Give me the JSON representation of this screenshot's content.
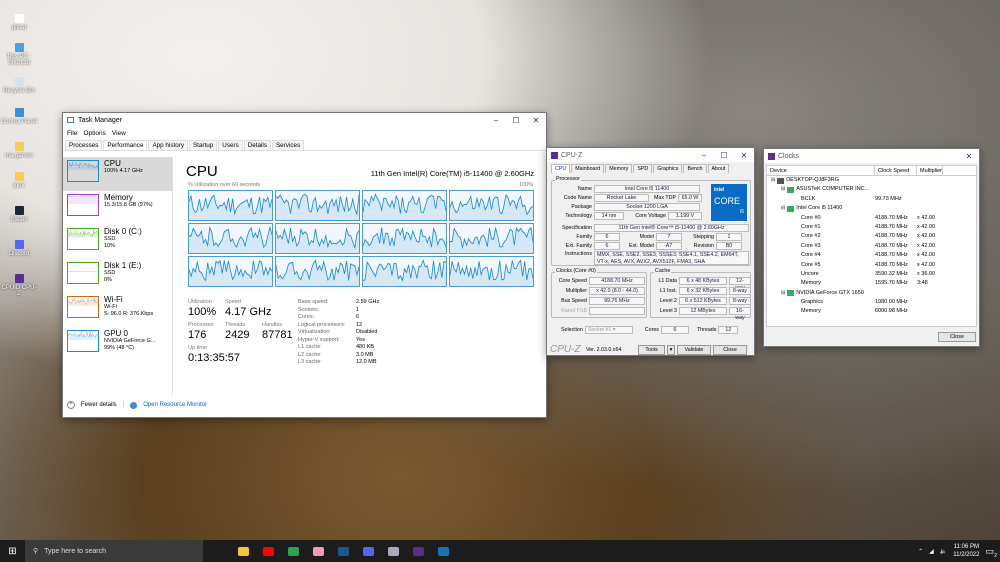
{
  "desktop": {
    "icons": [
      {
        "label": "pikad",
        "color": "#fff"
      },
      {
        "label": "This PC - Shortcut",
        "color": "#4aa3e0"
      },
      {
        "label": "Recycle Bin",
        "color": "#cfe3f5"
      },
      {
        "label": "Control Panel",
        "color": "#3c8fd6"
      },
      {
        "label": "ma games",
        "color": "#f3cd5b"
      },
      {
        "label": "junk",
        "color": "#f3cd5b"
      },
      {
        "label": "Steam",
        "color": "#1b2838"
      },
      {
        "label": "Discord",
        "color": "#5865f2"
      },
      {
        "label": "CPUID CPU-Z",
        "color": "#5b2d8e"
      }
    ]
  },
  "taskmanager": {
    "title": "Task Manager",
    "menu": [
      "File",
      "Options",
      "View"
    ],
    "tabs": [
      "Processes",
      "Performance",
      "App history",
      "Startup",
      "Users",
      "Details",
      "Services"
    ],
    "side": [
      {
        "name": "CPU",
        "l2": "100% 4.17 GHz",
        "l3": "",
        "color": "#1f8ad2"
      },
      {
        "name": "Memory",
        "l2": "15.3/15.8 GB (97%)",
        "l3": "",
        "color": "#a63ec9"
      },
      {
        "name": "Disk 0 (C:)",
        "l2": "SSD",
        "l3": "10%",
        "color": "#4da71f"
      },
      {
        "name": "Disk 1 (E:)",
        "l2": "SSD",
        "l3": "0%",
        "color": "#4da71f"
      },
      {
        "name": "Wi-Fi",
        "l2": "Wi-Fi",
        "l3": "S: 96.0 R: 376 Kbps",
        "color": "#c96a17"
      },
      {
        "name": "GPU 0",
        "l2": "NVIDIA GeForce G...",
        "l3": "99% (48 °C)",
        "color": "#1f8ad2"
      }
    ],
    "heading": "CPU",
    "model": "11th Gen Intel(R) Core(TM) i5-11400 @ 2.60GHz",
    "graph_label": "% Utilization over 60 seconds",
    "graph_max": "100%",
    "stats": {
      "utilization_l": "Utilization",
      "utilization": "100%",
      "speed_l": "Speed",
      "speed": "4.17 GHz",
      "processes_l": "Processes",
      "processes": "176",
      "threads_l": "Threads",
      "threads": "2429",
      "handles_l": "Handles",
      "handles": "87781",
      "uptime_l": "Up time",
      "uptime": "0:13:35:57"
    },
    "specs": [
      [
        "Base speed:",
        "2.59 GHz"
      ],
      [
        "Sockets:",
        "1"
      ],
      [
        "Cores:",
        "6"
      ],
      [
        "Logical processors:",
        "12"
      ],
      [
        "Virtualization:",
        "Disabled"
      ],
      [
        "Hyper-V support:",
        "Yes"
      ],
      [
        "L1 cache:",
        "480 KB"
      ],
      [
        "L2 cache:",
        "3.0 MB"
      ],
      [
        "L3 cache:",
        "12.0 MB"
      ]
    ],
    "fewer": "Fewer details",
    "monitor": "Open Resource Monitor"
  },
  "cpuz": {
    "title": "CPU-Z",
    "tabs": [
      "CPU",
      "Mainboard",
      "Memory",
      "SPD",
      "Graphics",
      "Bench",
      "About"
    ],
    "processor": "Processor",
    "name_l": "Name",
    "name": "Intel Core i5 11400",
    "codename_l": "Code Name",
    "codename": "Rocket Lake",
    "tdp_l": "Max TDP",
    "tdp": "65.0 W",
    "package_l": "Package",
    "package": "Socket 1200 LGA",
    "tech_l": "Technology",
    "tech": "14 nm",
    "volt_l": "Core Voltage",
    "volt": "1.199 V",
    "spec_l": "Specification",
    "spec": "11th Gen Intel® Core™ i5-11400 @ 2.60GHz",
    "family_l": "Family",
    "family": "6",
    "model_l": "Model",
    "model": "7",
    "stepping_l": "Stepping",
    "stepping": "1",
    "extfam_l": "Ext. Family",
    "extfam": "6",
    "extmod_l": "Ext. Model",
    "extmod": "A7",
    "rev_l": "Revision",
    "rev": "B0",
    "instr_l": "Instructions",
    "instr": "MMX, SSE, SSE2, SSE3, SSSE3, SSE4.1, SSE4.2, EM64T, VT-x, AES, AVX, AVX2, AVX512F, FMA3, SHA",
    "logo1": "intel",
    "logo2": "CORE",
    "logo3": "i5",
    "clocks_l": "Clocks (Core #0)",
    "corespeed_l": "Core Speed",
    "corespeed": "4188.70 MHz",
    "mult_l": "Multiplier",
    "mult": "x 42.0 (8.0 - 44.0)",
    "bus_l": "Bus Speed",
    "bus": "99.76 MHz",
    "fsb_l": "Rated FSB",
    "cache_l": "Cache",
    "cache": [
      [
        "L1 Data",
        "6 x 48 KBytes",
        "12-way"
      ],
      [
        "L1 Inst.",
        "6 x 32 KBytes",
        "8-way"
      ],
      [
        "Level 2",
        "6 x 512 KBytes",
        "8-way"
      ],
      [
        "Level 3",
        "12 MBytes",
        "16-way"
      ]
    ],
    "selection_l": "Selection",
    "selection": "Socket #1",
    "cores_l": "Cores",
    "cores": "6",
    "threads_l": "Threads",
    "threads": "12",
    "brand": "CPU-Z",
    "version": "Ver. 2.03.0.x64",
    "tools": "Tools",
    "validate": "Validate",
    "close": "Close"
  },
  "clocks": {
    "title": "Clocks",
    "cols": [
      "Device",
      "Clock Speed",
      "Multiplier"
    ],
    "rows": [
      [
        "DESKTOP-QJ8F3RG",
        "",
        "",
        0
      ],
      [
        "ASUSTeK COMPUTER INC...",
        "",
        "",
        1
      ],
      [
        "BCLK",
        "99.73 MHz",
        "",
        2
      ],
      [
        "Intel Core i5 11400",
        "",
        "",
        1
      ],
      [
        "Core #0",
        "4188.70 MHz",
        "x 42.00",
        2
      ],
      [
        "Core #1",
        "4188.70 MHz",
        "x 42.00",
        2
      ],
      [
        "Core #2",
        "4188.70 MHz",
        "x 42.00",
        2
      ],
      [
        "Core #3",
        "4188.70 MHz",
        "x 42.00",
        2
      ],
      [
        "Core #4",
        "4188.70 MHz",
        "x 42.00",
        2
      ],
      [
        "Core #5",
        "4188.70 MHz",
        "x 42.00",
        2
      ],
      [
        "Uncore",
        "3590.32 MHz",
        "x 36.00",
        2
      ],
      [
        "Memory",
        "1595.70 MHz",
        "3:48",
        2
      ],
      [
        "NVIDIA GeForce GTX 1650",
        "",
        "",
        1
      ],
      [
        "Graphics",
        "1980.00 MHz",
        "",
        2
      ],
      [
        "Memory",
        "6000.98 MHz",
        "",
        2
      ]
    ],
    "close": "Close"
  },
  "taskbar": {
    "search": "Type here to search",
    "apps": [
      {
        "name": "file-explorer",
        "color": "#f4c542"
      },
      {
        "name": "youtube",
        "color": "#f00"
      },
      {
        "name": "chrome",
        "color": "#2fa14f"
      },
      {
        "name": "octopus-app",
        "color": "#f59ab5"
      },
      {
        "name": "steam",
        "color": "#1b5a8a"
      },
      {
        "name": "discord",
        "color": "#5865f2"
      },
      {
        "name": "task-manager",
        "color": "#aab"
      },
      {
        "name": "cpuid",
        "color": "#5b2d8e"
      },
      {
        "name": "hwinfo",
        "color": "#1c6fb8"
      }
    ],
    "time": "11:06 PM",
    "date": "11/2/2022",
    "notifications": "2"
  }
}
